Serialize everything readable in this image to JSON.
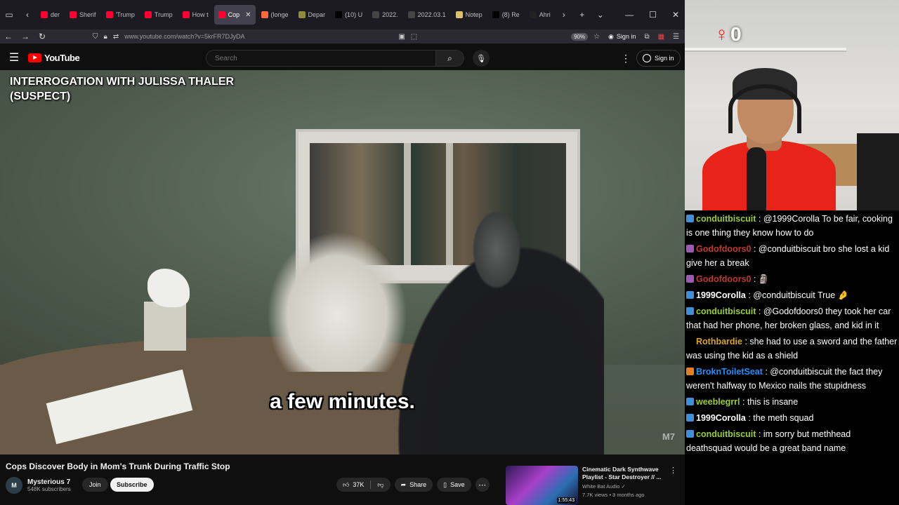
{
  "browser": {
    "tabs": [
      {
        "label": "der",
        "color": "#ff0033",
        "active": false
      },
      {
        "label": "Sherif",
        "color": "#ff0033",
        "active": false
      },
      {
        "label": "'Trump",
        "color": "#ff0033",
        "active": false
      },
      {
        "label": "Trump",
        "color": "#ff0033",
        "active": false
      },
      {
        "label": "How t",
        "color": "#ff0033",
        "active": false
      },
      {
        "label": "Cop",
        "color": "#ff0033",
        "active": true
      },
      {
        "label": "(longe",
        "color": "#ff6a3d",
        "active": false
      },
      {
        "label": "Depar",
        "color": "#8c8c3a",
        "active": false
      },
      {
        "label": "(10) U",
        "color": "#000000",
        "active": false
      },
      {
        "label": "2022.",
        "color": "#444444",
        "active": false
      },
      {
        "label": "2022.03.1",
        "color": "#444444",
        "active": false
      },
      {
        "label": "Notep",
        "color": "#d9c26b",
        "active": false
      },
      {
        "label": "(8) Re",
        "color": "#000000",
        "active": false
      },
      {
        "label": "Ahri",
        "color": "#222222",
        "active": false
      }
    ],
    "url": "www.youtube.com/watch?v=5krFR7DJyDA",
    "zoom": "90%",
    "signin_label": "Sign in"
  },
  "youtube": {
    "logo_text": "YouTube",
    "search_placeholder": "Search",
    "signin_label": "Sign in"
  },
  "video": {
    "overlay_title": "INTERROGATION WITH JULISSA THALER (SUSPECT)",
    "caption": "a few minutes.",
    "watermark": "M7"
  },
  "meta": {
    "title": "Cops Discover Body in Mom's Trunk During Traffic Stop",
    "channel_name": "Mysterious 7",
    "channel_initial": "M",
    "subscribers": "548K subscribers",
    "join_label": "Join",
    "subscribe_label": "Subscribe",
    "likes": "37K",
    "share_label": "Share",
    "save_label": "Save"
  },
  "recommended": {
    "title": "Cinematic Dark Synthwave Playlist - Star Destroyer // ...",
    "channel": "White Bat Audio",
    "meta": "7.7K views • 3 months ago",
    "duration": "1:55:43"
  },
  "stream": {
    "counter": "0"
  },
  "chat": [
    {
      "user": "conduitbiscuit",
      "color": "#9acd32",
      "badge": "#3f8fd9",
      "text": "@1999Corolla To be fair, cooking is one thing they know how to do"
    },
    {
      "user": "Godofdoors0",
      "color": "#c0392b",
      "badge": "#9b59b6",
      "text": "@conduitbiscuit bro she lost a kid give her a break"
    },
    {
      "user": "Godofdoors0",
      "color": "#c0392b",
      "badge": "#9b59b6",
      "text": "🗿"
    },
    {
      "user": "1999Corolla",
      "color": "#ffffff",
      "badge": "#3f8fd9",
      "text": "@conduitbiscuit True 🤌"
    },
    {
      "user": "conduitbiscuit",
      "color": "#9acd32",
      "badge": "#3f8fd9",
      "text": "@Godofdoors0 they took her car that had her phone, her broken glass, and kid in it"
    },
    {
      "user": "Rothbardie",
      "color": "#daa520",
      "badge": "",
      "text": "she had to use a sword and the father was using the kid as a shield"
    },
    {
      "user": "BroknToiletSeat",
      "color": "#1e90ff",
      "badge": "#e67e22",
      "text": "@conduitbiscuit the fact they weren't halfway to Mexico nails the stupidness"
    },
    {
      "user": "weeblegrrl",
      "color": "#9acd32",
      "badge": "#3f8fd9",
      "text": "this is insane"
    },
    {
      "user": "1999Corolla",
      "color": "#ffffff",
      "badge": "#3f8fd9",
      "text": "the meth squad"
    },
    {
      "user": "conduitbiscuit",
      "color": "#9acd32",
      "badge": "#3f8fd9",
      "text": "im sorry but methhead deathsquad would be a great band name"
    }
  ]
}
